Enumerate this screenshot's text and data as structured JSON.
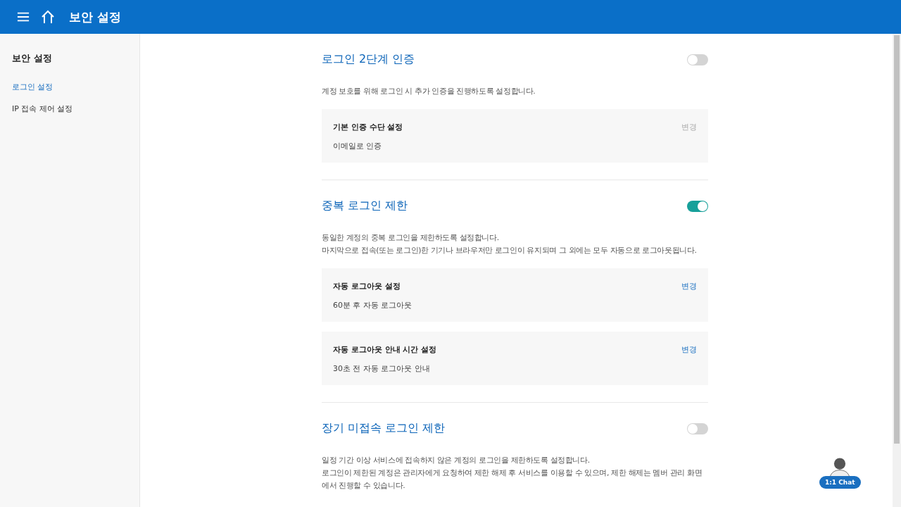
{
  "header": {
    "title": "보안 설정"
  },
  "sidebar": {
    "title": "보안 설정",
    "items": [
      {
        "label": "로그인 설정",
        "selected": true
      },
      {
        "label": "IP 접속 제어 설정",
        "selected": false
      }
    ]
  },
  "sections": [
    {
      "title": "로그인 2단계 인증",
      "on": false,
      "description": [
        "계정 보호를 위해 로그인 시 추가 인증을 진행하도록 설정합니다."
      ],
      "cards": [
        {
          "label": "기본 인증 수단 설정",
          "value": "이메일로 인증",
          "action": "변경",
          "disabled": true
        }
      ]
    },
    {
      "title": "중복 로그인 제한",
      "on": true,
      "description": [
        "동일한 계정의 중복 로그인을 제한하도록 설정합니다.",
        "마지막으로 접속(또는 로그인)한 기기나 브라우저만 로그인이 유지되며 그 외에는 모두 자동으로 로그아웃됩니다."
      ],
      "cards": [
        {
          "label": "자동 로그아웃 설정",
          "value": "60분 후 자동 로그아웃",
          "action": "변경",
          "disabled": false
        },
        {
          "label": "자동 로그아웃 안내 시간 설정",
          "value": "30초 전 자동 로그아웃 안내",
          "action": "변경",
          "disabled": false
        }
      ]
    },
    {
      "title": "장기 미접속 로그인 제한",
      "on": false,
      "description": [
        "일정 기간 이상 서비스에 접속하지 않은 계정의 로그인을 제한하도록 설정합니다.",
        "로그인이 제한된 계정은 관리자에게 요청하여 제한 해제 후 서비스를 이용할 수 있으며, 제한 해제는 멤버 관리 화면에서 진행할 수 있습니다."
      ]
    }
  ],
  "chat": {
    "label": "1:1 Chat"
  }
}
